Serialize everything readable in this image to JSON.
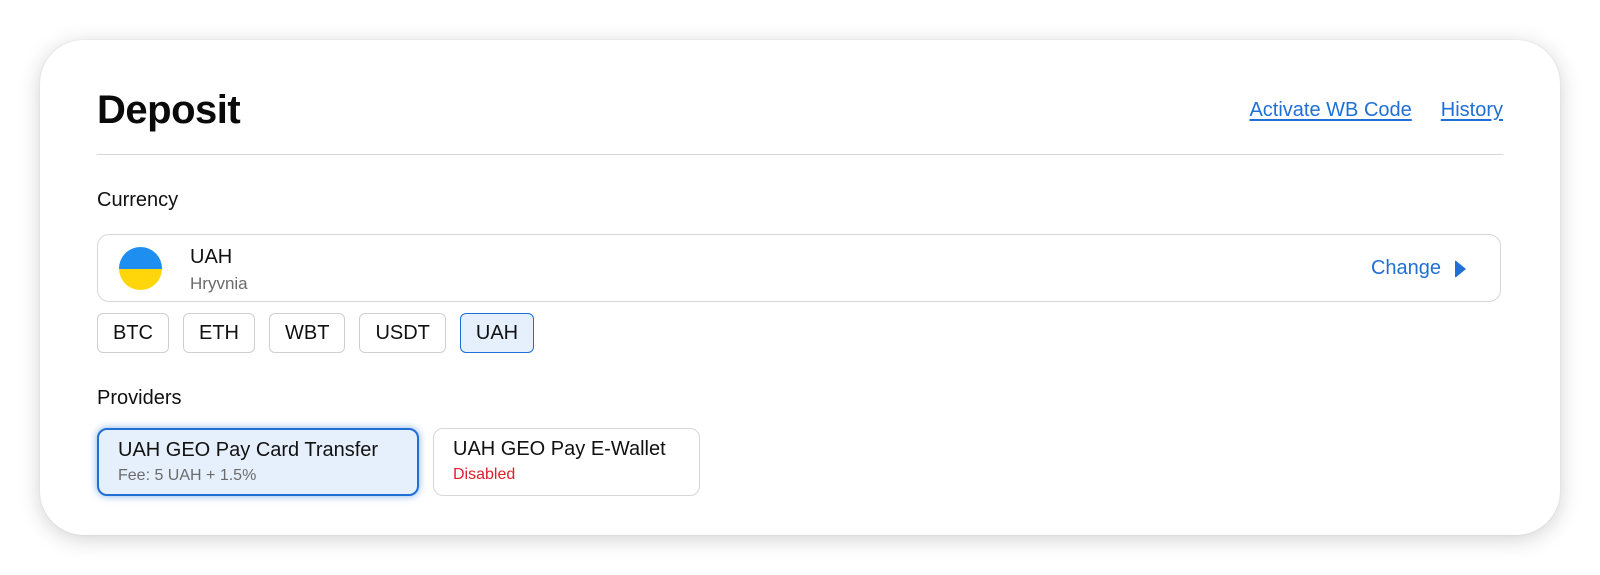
{
  "header": {
    "title": "Deposit",
    "links": [
      "Activate WB Code",
      "History"
    ]
  },
  "currency": {
    "section_label": "Currency",
    "selected_code": "UAH",
    "selected_name": "Hryvnia",
    "change_label": "Change",
    "flag_icon": "ukraine-flag-icon",
    "flag_colors": [
      "#1e8ef0",
      "#ffd60a"
    ],
    "chips": [
      "BTC",
      "ETH",
      "WBT",
      "USDT",
      "UAH"
    ],
    "active_chip": "UAH"
  },
  "providers": {
    "section_label": "Providers",
    "items": [
      {
        "name": "UAH GEO Pay Card Transfer",
        "subtitle": "Fee: 5 UAH + 1.5%",
        "state": "selected"
      },
      {
        "name": "UAH GEO Pay E-Wallet",
        "subtitle": "Disabled",
        "state": "disabled"
      }
    ]
  },
  "colors": {
    "accent": "#1f6fd6",
    "selected_bg": "#e6f0fd",
    "error": "#e0202a"
  }
}
